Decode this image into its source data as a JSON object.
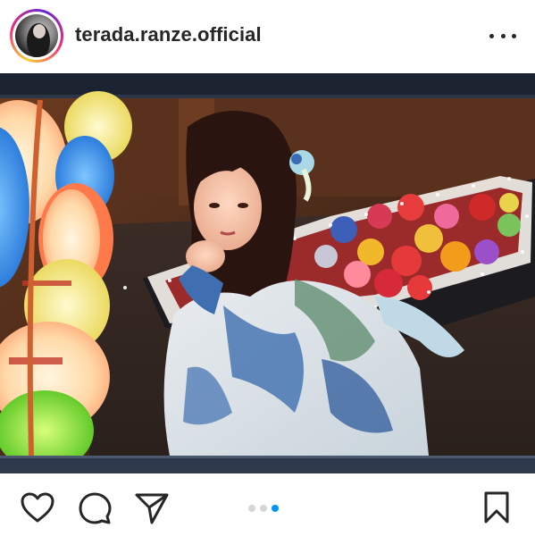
{
  "post": {
    "username": "terada.ranze.official",
    "carousel": {
      "count": 3,
      "active_index": 2
    }
  },
  "colors": {
    "accent": "#0095f6",
    "text": "#262626",
    "inactive_dot": "#d6d6d6"
  },
  "icons": {
    "more": "more-options-icon",
    "like": "heart-icon",
    "comment": "comment-icon",
    "share": "send-icon",
    "save": "bookmark-icon"
  }
}
